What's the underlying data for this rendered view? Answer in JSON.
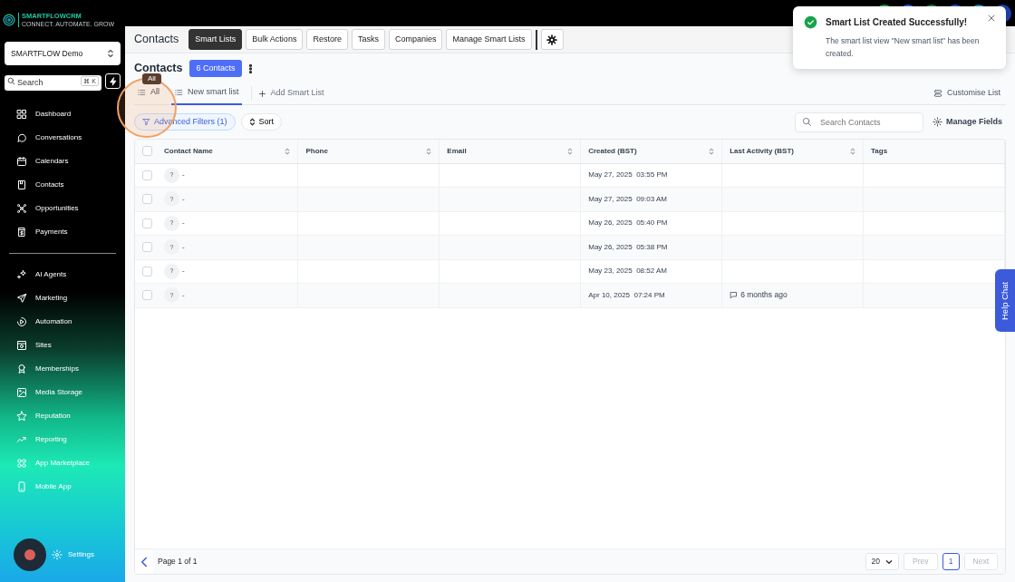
{
  "brand": {
    "name": "SMARTFLOWCRM",
    "tagline": "CONNECT. AUTOMATE. GROW"
  },
  "account_switcher": {
    "value": "SMARTFLOW Demo"
  },
  "search": {
    "placeholder": "Search",
    "shortcut": "⌘ K"
  },
  "sidebar": {
    "items": [
      {
        "label": "Dashboard"
      },
      {
        "label": "Conversations"
      },
      {
        "label": "Calendars"
      },
      {
        "label": "Contacts"
      },
      {
        "label": "Opportunities"
      },
      {
        "label": "Payments"
      }
    ],
    "tools": [
      {
        "label": "AI Agents"
      },
      {
        "label": "Marketing"
      },
      {
        "label": "Automation"
      },
      {
        "label": "Sites"
      },
      {
        "label": "Memberships"
      },
      {
        "label": "Media Storage"
      },
      {
        "label": "Reputation"
      },
      {
        "label": "Reporting"
      },
      {
        "label": "App Marketplace"
      },
      {
        "label": "Mobile App"
      }
    ],
    "bottom": {
      "label": "Settings"
    }
  },
  "header": {
    "title": "Contacts",
    "tabs": [
      {
        "label": "Smart Lists",
        "selected": true
      },
      {
        "label": "Bulk Actions",
        "selected": false
      },
      {
        "label": "Restore",
        "selected": false
      },
      {
        "label": "Tasks",
        "selected": false
      },
      {
        "label": "Companies",
        "selected": false
      },
      {
        "label": "Manage Smart Lists",
        "selected": false
      }
    ]
  },
  "page": {
    "title": "Contacts",
    "count": "6 Contacts"
  },
  "tooltip": "All",
  "views": [
    {
      "label": "All",
      "selected": false
    },
    {
      "label": "New smart list",
      "selected": true
    }
  ],
  "add_view": "Add Smart List",
  "customise": "Customise List",
  "filters": {
    "advanced": "Advanced Filters (1)",
    "sort": "Sort"
  },
  "search_contacts": {
    "placeholder": "Search Contacts"
  },
  "manage_fields": "Manage Fields",
  "table": {
    "select_all": {
      "checked": false
    },
    "columns": [
      {
        "label": "Contact Name",
        "sortable": true
      },
      {
        "label": "Phone",
        "sortable": true
      },
      {
        "label": "Email",
        "sortable": true
      },
      {
        "label": "Created (BST)",
        "sortable": true
      },
      {
        "label": "Last Activity (BST)",
        "sortable": true
      },
      {
        "label": "Tags",
        "sortable": false
      }
    ],
    "rows": [
      {
        "checked": false,
        "avatar": "?",
        "name": "-",
        "created": "May 27, 2025  03:55 PM"
      },
      {
        "checked": false,
        "avatar": "?",
        "name": "-",
        "created": "May 27, 2025  09:03 AM"
      },
      {
        "checked": false,
        "avatar": "?",
        "name": "-",
        "created": "May 26, 2025  05:40 PM"
      },
      {
        "checked": false,
        "avatar": "?",
        "name": "-",
        "created": "May 26, 2025  05:38 PM"
      },
      {
        "checked": false,
        "avatar": "?",
        "name": "-",
        "created": "May 23, 2025  08:52 AM"
      },
      {
        "checked": false,
        "avatar": "?",
        "name": "-",
        "created": "Apr 10, 2025  07:24 PM",
        "last_activity": "6 months ago"
      }
    ]
  },
  "pagination": {
    "summary": "Page 1 of 1",
    "page_size": "20",
    "prev": {
      "label": "Prev",
      "disabled": true
    },
    "pages": [
      {
        "label": "1",
        "selected": true
      }
    ],
    "next": {
      "label": "Next",
      "disabled": true
    }
  },
  "toast": {
    "title": "Smart List Created Successfully!",
    "message": "The smart list view \"New smart list\" has been created."
  },
  "help_chat": "Help Chat"
}
